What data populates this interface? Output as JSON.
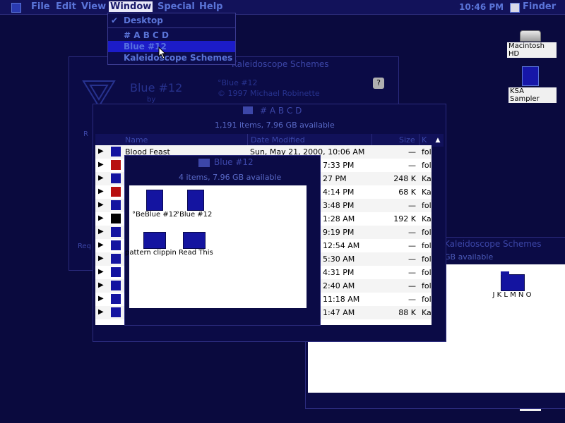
{
  "menubar": {
    "items": [
      "File",
      "Edit",
      "View",
      "Window",
      "Special",
      "Help"
    ],
    "clock": "10:46 PM",
    "app": "Finder"
  },
  "window_menu": {
    "items": [
      "Desktop",
      "# A B C D",
      "Blue #12",
      "Kaleidoscope Schemes"
    ],
    "checked": "Desktop"
  },
  "desktop": {
    "icons": [
      "Macintosh HD",
      "KSA Sampler",
      "Trash"
    ]
  },
  "bg_window": {
    "title": "Kaleidoscope Schemes",
    "scheme_name": "Blue #12",
    "scheme_sub": "by",
    "info_line1": "°Blue #12",
    "info_line2": "© 1997 Michael Robinette",
    "rx_label": "Req",
    "misc_label": "R"
  },
  "list_window": {
    "title": "# A B C D",
    "subtitle": "1,191 items, 7.96 GB available",
    "columns": [
      "Name",
      "Date Modified",
      "Size",
      "K"
    ],
    "rows": [
      {
        "name": "Blood Feast",
        "date": "Sun, May 21, 2000, 10:06 AM",
        "size": "—",
        "kind": "fol"
      },
      {
        "name": "",
        "date": "7:33 PM",
        "size": "—",
        "kind": "fol"
      },
      {
        "name": "",
        "date": "27 PM",
        "size": "248 K",
        "kind": "Ka"
      },
      {
        "name": "",
        "date": "4:14 PM",
        "size": "68 K",
        "kind": "Ka"
      },
      {
        "name": "",
        "date": "3:48 PM",
        "size": "—",
        "kind": "fol"
      },
      {
        "name": "",
        "date": "1:28 AM",
        "size": "192 K",
        "kind": "Ka"
      },
      {
        "name": "",
        "date": "9:19 PM",
        "size": "—",
        "kind": "fol"
      },
      {
        "name": "",
        "date": "12:54 AM",
        "size": "—",
        "kind": "fol"
      },
      {
        "name": "",
        "date": "5:30 AM",
        "size": "—",
        "kind": "fol"
      },
      {
        "name": "",
        "date": "4:31 PM",
        "size": "—",
        "kind": "fol"
      },
      {
        "name": "",
        "date": "2:40 AM",
        "size": "—",
        "kind": "fol"
      },
      {
        "name": "",
        "date": "11:18 AM",
        "size": "—",
        "kind": "fol"
      },
      {
        "name": "",
        "date": "1:47 AM",
        "size": "88 K",
        "kind": "Ka"
      }
    ]
  },
  "small_window": {
    "title": "Blue #12",
    "subtitle": "4 items, 7.96 GB available",
    "icons": [
      "°BeBlue #12",
      "°Blue #12",
      "pattern clippin",
      "Read This"
    ]
  },
  "kal_window": {
    "title": "Kaleidoscope Schemes",
    "subtitle": "GB available",
    "folder": "J K L M N O"
  },
  "colors": {
    "background": "#0a0a3e",
    "menu_text": "#5a74d8",
    "highlight": "#1c1cc8",
    "folder": "#1414a0"
  }
}
